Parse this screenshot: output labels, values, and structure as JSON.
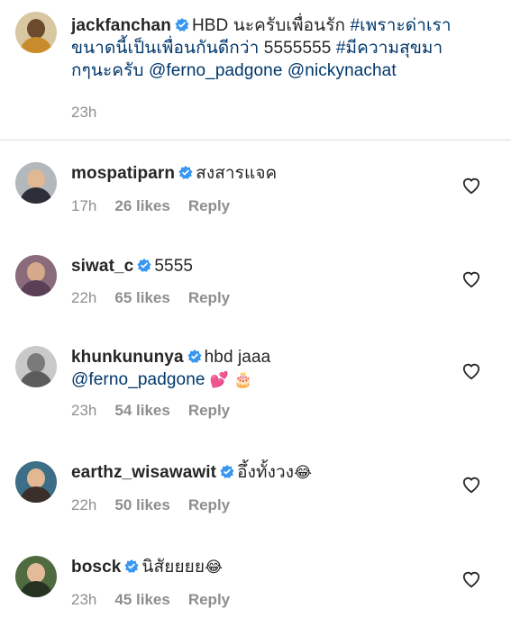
{
  "caption": {
    "username": "jackfanchan",
    "text_1": "HBD นะครับเพื่อนรัก ",
    "hashtag_1": "#เพราะด่าเรา",
    "line2_hashtag_cont": "ขนาดนี้เป็นเพื่อนกันดีกว่า",
    "text_2": " 5555555 ",
    "hashtag_2": "#มีความสุขมา",
    "line3_hashtag_cont": "กๆนะครับ",
    "mention_1": "@ferno_padgone",
    "mention_2": "@nickynachat",
    "time": "23h"
  },
  "comments": [
    {
      "username": "mospatiparn",
      "text": "สงสารแจค",
      "time": "17h",
      "likes": "26 likes",
      "reply": "Reply"
    },
    {
      "username": "siwat_c",
      "text": "5555",
      "time": "22h",
      "likes": "65 likes",
      "reply": "Reply"
    },
    {
      "username": "khunkununya",
      "text": "hbd jaaa",
      "mention": "@ferno_padgone",
      "emoji": "💕 🎂",
      "time": "23h",
      "likes": "54 likes",
      "reply": "Reply"
    },
    {
      "username": "earthz_wisawawit",
      "text": "อึ้งทั้งวง",
      "emoji": "😂",
      "time": "22h",
      "likes": "50 likes",
      "reply": "Reply"
    },
    {
      "username": "bosck",
      "text": "นิสัยยยย",
      "emoji": "😂",
      "time": "23h",
      "likes": "45 likes",
      "reply": "Reply"
    }
  ],
  "colors": {
    "verified": "#3897f0",
    "link": "#00376b",
    "meta": "#8e8e8e",
    "divider": "#dbdbdb"
  },
  "icons": {
    "verified": "verified-badge-icon",
    "heart": "heart-outline-icon"
  }
}
